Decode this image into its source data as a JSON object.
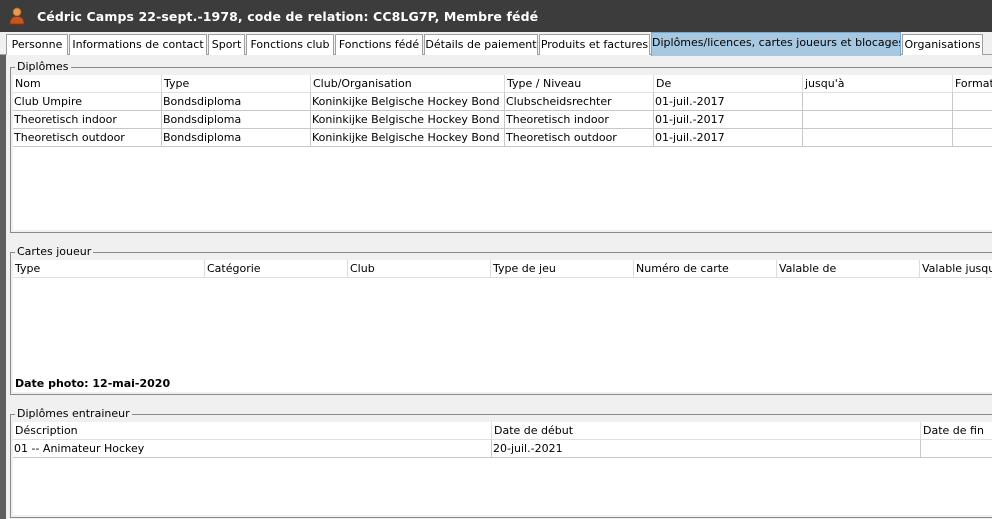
{
  "window": {
    "title": "Cédric Camps 22-sept.-1978, code de relation: CC8LG7P, Membre fédé",
    "icon": "person-icon"
  },
  "tabs": [
    {
      "label": "Personne",
      "active": false
    },
    {
      "label": "Informations de contact",
      "active": false
    },
    {
      "label": "Sport",
      "active": false
    },
    {
      "label": "Fonctions club",
      "active": false
    },
    {
      "label": "Fonctions fédé",
      "active": false
    },
    {
      "label": "Détails de paiement",
      "active": false
    },
    {
      "label": "Produits et factures",
      "active": false
    },
    {
      "label": "Diplômes/licences, cartes joueurs et blocages",
      "active": true
    },
    {
      "label": "Organisations",
      "active": false
    }
  ],
  "diplomas": {
    "legend": "Diplômes",
    "columns": [
      "Nom",
      "Type",
      "Club/Organisation",
      "Type / Niveau",
      "De",
      "jusqu'à",
      "Format"
    ],
    "rows": [
      [
        "Club Umpire",
        "Bondsdiploma",
        "Koninkijke Belgische Hockey Bond",
        "Clubscheidsrechter",
        "01-juil.-2017",
        "",
        ""
      ],
      [
        "Theoretisch indoor",
        "Bondsdiploma",
        "Koninkijke Belgische Hockey Bond",
        "Theoretisch indoor",
        "01-juil.-2017",
        "",
        ""
      ],
      [
        "Theoretisch outdoor",
        "Bondsdiploma",
        "Koninkijke Belgische Hockey Bond",
        "Theoretisch outdoor",
        "01-juil.-2017",
        "",
        ""
      ]
    ]
  },
  "player_cards": {
    "legend": "Cartes joueur",
    "columns": [
      "Type",
      "Catégorie",
      "Club",
      "Type de jeu",
      "Numéro de carte",
      "Valable de",
      "Valable jusqu'à"
    ],
    "rows": [],
    "photo_date": "Date photo: 12-mai-2020"
  },
  "coach_diplomas": {
    "legend": "Diplômes entraineur",
    "columns": [
      "Déscription",
      "Date de début",
      "Date de fin"
    ],
    "rows": [
      [
        "01 -- Animateur Hockey",
        "20-juil.-2021",
        ""
      ]
    ]
  }
}
